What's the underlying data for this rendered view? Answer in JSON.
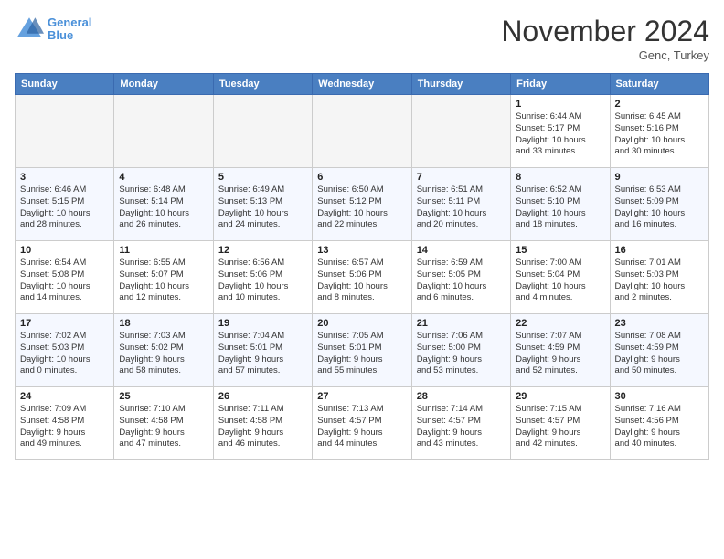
{
  "header": {
    "logo_line1": "General",
    "logo_line2": "Blue",
    "month": "November 2024",
    "location": "Genc, Turkey"
  },
  "weekdays": [
    "Sunday",
    "Monday",
    "Tuesday",
    "Wednesday",
    "Thursday",
    "Friday",
    "Saturday"
  ],
  "weeks": [
    [
      {
        "day": "",
        "detail": ""
      },
      {
        "day": "",
        "detail": ""
      },
      {
        "day": "",
        "detail": ""
      },
      {
        "day": "",
        "detail": ""
      },
      {
        "day": "",
        "detail": ""
      },
      {
        "day": "1",
        "detail": "Sunrise: 6:44 AM\nSunset: 5:17 PM\nDaylight: 10 hours\nand 33 minutes."
      },
      {
        "day": "2",
        "detail": "Sunrise: 6:45 AM\nSunset: 5:16 PM\nDaylight: 10 hours\nand 30 minutes."
      }
    ],
    [
      {
        "day": "3",
        "detail": "Sunrise: 6:46 AM\nSunset: 5:15 PM\nDaylight: 10 hours\nand 28 minutes."
      },
      {
        "day": "4",
        "detail": "Sunrise: 6:48 AM\nSunset: 5:14 PM\nDaylight: 10 hours\nand 26 minutes."
      },
      {
        "day": "5",
        "detail": "Sunrise: 6:49 AM\nSunset: 5:13 PM\nDaylight: 10 hours\nand 24 minutes."
      },
      {
        "day": "6",
        "detail": "Sunrise: 6:50 AM\nSunset: 5:12 PM\nDaylight: 10 hours\nand 22 minutes."
      },
      {
        "day": "7",
        "detail": "Sunrise: 6:51 AM\nSunset: 5:11 PM\nDaylight: 10 hours\nand 20 minutes."
      },
      {
        "day": "8",
        "detail": "Sunrise: 6:52 AM\nSunset: 5:10 PM\nDaylight: 10 hours\nand 18 minutes."
      },
      {
        "day": "9",
        "detail": "Sunrise: 6:53 AM\nSunset: 5:09 PM\nDaylight: 10 hours\nand 16 minutes."
      }
    ],
    [
      {
        "day": "10",
        "detail": "Sunrise: 6:54 AM\nSunset: 5:08 PM\nDaylight: 10 hours\nand 14 minutes."
      },
      {
        "day": "11",
        "detail": "Sunrise: 6:55 AM\nSunset: 5:07 PM\nDaylight: 10 hours\nand 12 minutes."
      },
      {
        "day": "12",
        "detail": "Sunrise: 6:56 AM\nSunset: 5:06 PM\nDaylight: 10 hours\nand 10 minutes."
      },
      {
        "day": "13",
        "detail": "Sunrise: 6:57 AM\nSunset: 5:06 PM\nDaylight: 10 hours\nand 8 minutes."
      },
      {
        "day": "14",
        "detail": "Sunrise: 6:59 AM\nSunset: 5:05 PM\nDaylight: 10 hours\nand 6 minutes."
      },
      {
        "day": "15",
        "detail": "Sunrise: 7:00 AM\nSunset: 5:04 PM\nDaylight: 10 hours\nand 4 minutes."
      },
      {
        "day": "16",
        "detail": "Sunrise: 7:01 AM\nSunset: 5:03 PM\nDaylight: 10 hours\nand 2 minutes."
      }
    ],
    [
      {
        "day": "17",
        "detail": "Sunrise: 7:02 AM\nSunset: 5:03 PM\nDaylight: 10 hours\nand 0 minutes."
      },
      {
        "day": "18",
        "detail": "Sunrise: 7:03 AM\nSunset: 5:02 PM\nDaylight: 9 hours\nand 58 minutes."
      },
      {
        "day": "19",
        "detail": "Sunrise: 7:04 AM\nSunset: 5:01 PM\nDaylight: 9 hours\nand 57 minutes."
      },
      {
        "day": "20",
        "detail": "Sunrise: 7:05 AM\nSunset: 5:01 PM\nDaylight: 9 hours\nand 55 minutes."
      },
      {
        "day": "21",
        "detail": "Sunrise: 7:06 AM\nSunset: 5:00 PM\nDaylight: 9 hours\nand 53 minutes."
      },
      {
        "day": "22",
        "detail": "Sunrise: 7:07 AM\nSunset: 4:59 PM\nDaylight: 9 hours\nand 52 minutes."
      },
      {
        "day": "23",
        "detail": "Sunrise: 7:08 AM\nSunset: 4:59 PM\nDaylight: 9 hours\nand 50 minutes."
      }
    ],
    [
      {
        "day": "24",
        "detail": "Sunrise: 7:09 AM\nSunset: 4:58 PM\nDaylight: 9 hours\nand 49 minutes."
      },
      {
        "day": "25",
        "detail": "Sunrise: 7:10 AM\nSunset: 4:58 PM\nDaylight: 9 hours\nand 47 minutes."
      },
      {
        "day": "26",
        "detail": "Sunrise: 7:11 AM\nSunset: 4:58 PM\nDaylight: 9 hours\nand 46 minutes."
      },
      {
        "day": "27",
        "detail": "Sunrise: 7:13 AM\nSunset: 4:57 PM\nDaylight: 9 hours\nand 44 minutes."
      },
      {
        "day": "28",
        "detail": "Sunrise: 7:14 AM\nSunset: 4:57 PM\nDaylight: 9 hours\nand 43 minutes."
      },
      {
        "day": "29",
        "detail": "Sunrise: 7:15 AM\nSunset: 4:57 PM\nDaylight: 9 hours\nand 42 minutes."
      },
      {
        "day": "30",
        "detail": "Sunrise: 7:16 AM\nSunset: 4:56 PM\nDaylight: 9 hours\nand 40 minutes."
      }
    ]
  ]
}
